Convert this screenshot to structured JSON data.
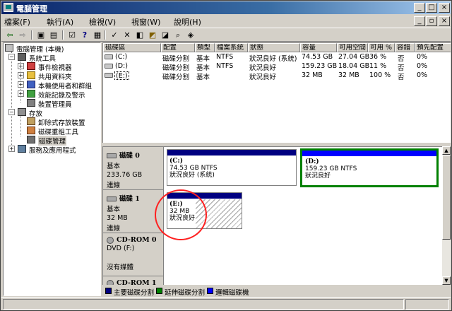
{
  "window": {
    "title": "電腦管理",
    "caption_buttons": [
      "_",
      "□",
      "×"
    ]
  },
  "menubar": {
    "items": [
      "檔案(F)",
      "執行(A)",
      "檢視(V)",
      "視窗(W)",
      "說明(H)"
    ],
    "mdi_buttons": [
      "_",
      "▫",
      "×"
    ]
  },
  "toolbar": {
    "buttons": [
      {
        "name": "back-icon",
        "glyph": "⇦"
      },
      {
        "name": "forward-icon",
        "glyph": "⇨"
      },
      {
        "name": "up-folder-icon",
        "glyph": "▣"
      },
      {
        "name": "show-tree-icon",
        "glyph": "▤"
      },
      {
        "name": "properties-icon",
        "glyph": "☑"
      },
      {
        "name": "help-icon",
        "glyph": "?"
      },
      {
        "name": "export-icon",
        "glyph": "▦"
      },
      {
        "name": "check-icon",
        "glyph": "✓"
      },
      {
        "name": "delete-icon",
        "glyph": "✕"
      },
      {
        "name": "format-icon",
        "glyph": "◧"
      },
      {
        "name": "open-folder-icon",
        "glyph": "◩"
      },
      {
        "name": "explore-icon",
        "glyph": "◪"
      },
      {
        "name": "search-icon",
        "glyph": "⌕"
      },
      {
        "name": "settings-icon",
        "glyph": "◈"
      }
    ]
  },
  "tree": {
    "root": "電腦管理 (本機)",
    "system_tools": "系統工具",
    "event_viewer": "事件檢視器",
    "shared_folders": "共用資料夾",
    "local_users": "本機使用者和群組",
    "perf_logs": "效能記錄及警示",
    "device_manager": "裝置管理員",
    "storage": "存放",
    "removable_storage": "卸除式存放裝置",
    "defrag": "磁碟重組工具",
    "disk_mgmt": "磁碟管理",
    "services": "服務及應用程式"
  },
  "volume_list": {
    "columns": [
      "磁碟區",
      "配置",
      "類型",
      "檔案系統",
      "狀態",
      "容量",
      "可用空間",
      "可用 %",
      "容錯",
      "預先配置"
    ],
    "rows": [
      {
        "vol": "(C:)",
        "layout": "磁碟分割",
        "type": "基本",
        "fs": "NTFS",
        "status": "狀況良好 (系統)",
        "capacity": "74.53 GB",
        "free": "27.04 GB",
        "pct": "36 %",
        "ft": "否",
        "overhead": "0%"
      },
      {
        "vol": "(D:)",
        "layout": "磁碟分割",
        "type": "基本",
        "fs": "NTFS",
        "status": "狀況良好",
        "capacity": "159.23 GB",
        "free": "18.04 GB",
        "pct": "11 %",
        "ft": "否",
        "overhead": "0%"
      },
      {
        "vol": "(E:)",
        "layout": "磁碟分割",
        "type": "基本",
        "fs": "",
        "status": "狀況良好",
        "capacity": "32 MB",
        "free": "32 MB",
        "pct": "100 %",
        "ft": "否",
        "overhead": "0%"
      }
    ]
  },
  "disks": {
    "disk0": {
      "name": "磁碟 0",
      "type": "基本",
      "size": "233.76 GB",
      "state": "連線"
    },
    "disk1": {
      "name": "磁碟 1",
      "type": "基本",
      "size": "32 MB",
      "state": "連線"
    },
    "cdrom0": {
      "name": "CD-ROM 0",
      "type": "DVD (F:)",
      "media": "沒有媒體"
    },
    "cdrom1": {
      "name": "CD-ROM 1"
    }
  },
  "partitions": {
    "c": {
      "name": "(C:)",
      "size": "74.53 GB NTFS",
      "status": "狀況良好 (系統)"
    },
    "d": {
      "name": "(D:)",
      "size": "159.23 GB NTFS",
      "status": "狀況良好"
    },
    "e": {
      "name": "(E:)",
      "size": "32 MB",
      "status": "狀況良好"
    }
  },
  "legend": {
    "primary": "主要磁碟分割",
    "extended": "延伸磁碟分割",
    "logical": "邏輯磁碟機"
  },
  "colors": {
    "primary": "#000080",
    "extended": "#008000",
    "logical": "#0000ff",
    "selection": "#008000",
    "highlight_circle": "#ff2020"
  }
}
